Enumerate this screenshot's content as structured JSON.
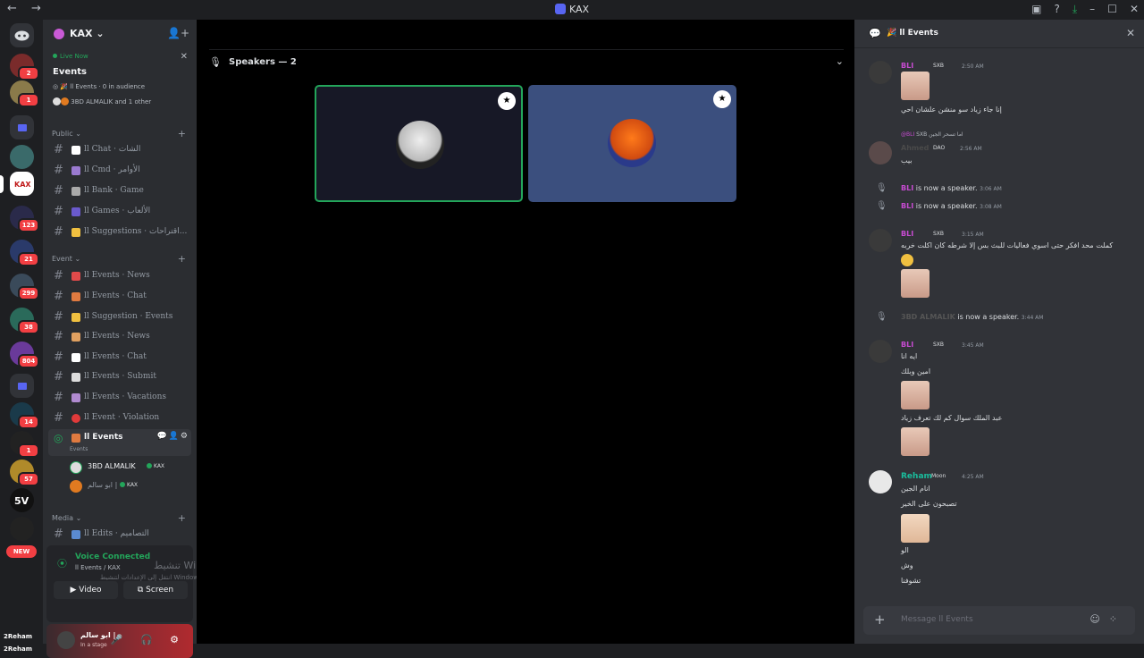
{
  "titlebar": {
    "nav": "← →",
    "title": "KAX"
  },
  "servers": {
    "badges": {
      "s1": "2",
      "s2": "1",
      "s3": "123",
      "s4": "21",
      "s5": "299",
      "s6": "38",
      "s7": "804",
      "s8": "14",
      "s9": "1",
      "s10": "57"
    },
    "new_label": "NEW"
  },
  "guild": {
    "name": "KAX"
  },
  "live": {
    "status": "Live Now",
    "title": "Events",
    "stage_line": "ll Events · 0 in audience",
    "members_line": "3BD ALMALIK and 1 other"
  },
  "categories": {
    "public": "Public",
    "event": "Event",
    "media": "Media"
  },
  "channels": {
    "public": [
      {
        "label": "ll Chat · الشات"
      },
      {
        "label": "ll Cmd · الأوامر"
      },
      {
        "label": "ll Bank · Game"
      },
      {
        "label": "ll Games · الألعاب"
      },
      {
        "label": "ll Suggestions · اقتراحات..."
      }
    ],
    "event": [
      {
        "label": "ll Events · News"
      },
      {
        "label": "ll Events · Chat"
      },
      {
        "label": "ll Suggestion · Events"
      },
      {
        "label": "ll Events · News"
      },
      {
        "label": "ll Events · Chat"
      },
      {
        "label": "ll Events · Submit"
      },
      {
        "label": "ll Events · Vacations"
      },
      {
        "label": "ll Event · Violation"
      }
    ],
    "active": {
      "label": "ll Events",
      "sub": "Events"
    },
    "media": [
      {
        "label": "ll Edits · التصاميم"
      }
    ]
  },
  "stage_members": [
    {
      "name": "3BD ALMALIK",
      "tag": "KAX"
    },
    {
      "name": "ابو سالم |",
      "tag": "KAX"
    }
  ],
  "voice": {
    "status": "Voice Connected",
    "channel": "ll Events / KAX",
    "video_label": "Video",
    "screen_label": "Screen",
    "watermark1": "تنشيط Windows",
    "watermark2": "انتقل إلى الإعدادات لتنشيط Windows"
  },
  "user": {
    "name": "ابو سالم |",
    "status": "In a stage",
    "over1": "2Reham",
    "over2": "2Reham"
  },
  "main": {
    "speakers_title": "Speakers — 2"
  },
  "chat": {
    "header": "ll Events",
    "messages": {
      "m1": {
        "name": "BLI",
        "tag": "SXB",
        "time": "2:50 AM",
        "text": "إنا جاء زياد سو منشن علشان احي"
      },
      "m2": {
        "reply_name": "@BLI",
        "reply_tag": "SXB",
        "reply_text": "اما تسحر الجين",
        "name": "Ahmed",
        "tag": "DAO",
        "time": "2:56 AM",
        "text": "بيب"
      },
      "s1": {
        "who": "BLI",
        "text": "is now a speaker.",
        "time": "3:06 AM"
      },
      "s2": {
        "who": "BLI",
        "text": "is now a speaker.",
        "time": "3:08 AM"
      },
      "m3": {
        "name": "BLI",
        "tag": "SXB",
        "time": "3:15 AM",
        "text": "كملت محد افكر حتى اسوي فعاليات للبث بس إلا شرطه كان اكلت خربه"
      },
      "s3": {
        "who": "3BD ALMALIK",
        "text": "is now a speaker.",
        "time": "3:44 AM"
      },
      "m4": {
        "name": "BLI",
        "tag": "SXB",
        "time": "3:45 AM",
        "t1": "ايه انا",
        "t2": "امين وبلك",
        "t3": "عبد الملك سوال كم لك تعرف زياد"
      },
      "m5": {
        "name": "Reham",
        "tag": "Moon",
        "time": "4:25 AM",
        "t1": "انام الجين",
        "t2": "تصبحون على الخير",
        "t3": "الو",
        "t4": "وش",
        "t5": "تشوفنا"
      }
    },
    "composer_placeholder": "Message ll Events"
  }
}
